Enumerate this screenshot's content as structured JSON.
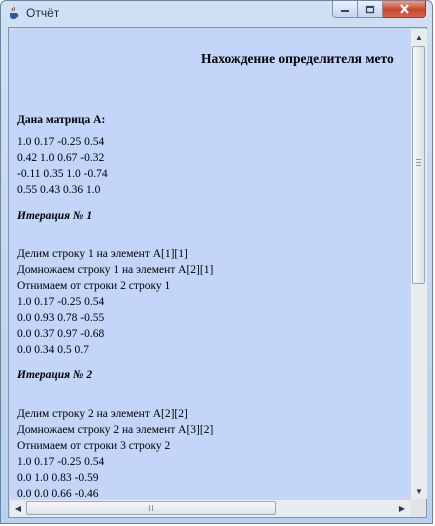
{
  "window": {
    "title": "Отчёт",
    "icon": "java-cup-icon",
    "buttons": [
      "minimize-icon",
      "maximize-icon",
      "close-icon"
    ]
  },
  "report": {
    "heading": "Нахождение определителя мето",
    "matrix_label": "Дана матрица А:",
    "matrix_rows": [
      "1.0 0.17 -0.25 0.54",
      "0.42 1.0 0.67 -0.32",
      "-0.11 0.35 1.0 -0.74",
      "0.55 0.43 0.36 1.0"
    ],
    "iterations": [
      {
        "title": "Итерация № 1",
        "steps": [
          "Делим строку 1 на элемент A[1][1]",
          "Домножаем строку 1 на элемент A[2][1]",
          "Отнимаем от строки 2 строку 1"
        ],
        "rows": [
          "1.0 0.17 -0.25 0.54",
          "0.0 0.93 0.78 -0.55",
          "0.0 0.37 0.97 -0.68",
          "0.0 0.34 0.5 0.7"
        ]
      },
      {
        "title": "Итерация № 2",
        "steps": [
          "Делим строку 2 на элемент A[2][2]",
          "Домножаем строку 2 на элемент A[3][2]",
          "Отнимаем от строки 3 строку 2"
        ],
        "rows": [
          "1.0 0.17 -0.25 0.54",
          "0.0 1.0 0.83 -0.59",
          "0.0 0.0 0.66 -0.46"
        ]
      }
    ]
  },
  "scrollbars": {
    "vertical_position": 0.0,
    "horizontal_position": 0.0
  }
}
